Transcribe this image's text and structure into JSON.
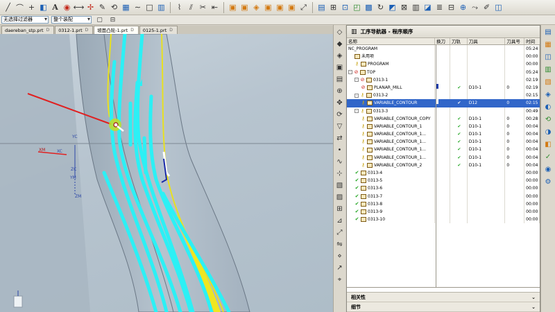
{
  "toolbar": {
    "filter_combo": "无选择过滤器",
    "assembly_combo": "整个装配"
  },
  "tabs": [
    {
      "label": "daereban_stp.prt",
      "active": false
    },
    {
      "label": "0312-1.prt",
      "active": false
    },
    {
      "label": "坡面凸轮-1.prt",
      "active": true
    },
    {
      "label": "0125-1.prt",
      "active": false
    }
  ],
  "viewport": {
    "axis_labels": [
      "YC",
      "ZC",
      "XC",
      "ZM",
      "YM",
      "XM"
    ]
  },
  "navigator": {
    "title": "工序导航器 - 程序顺序",
    "columns": {
      "name": "名称",
      "tool_change": "换刀",
      "path": "刀轨",
      "tool": "刀具",
      "tool_no": "刀具号",
      "time": "时间"
    },
    "rows": [
      {
        "indent": 0,
        "name": "NC_PROGRAM",
        "tool_change": "",
        "path": "",
        "tool": "",
        "tool_no": "",
        "time": "05:24",
        "expander": "",
        "status": "",
        "op_icon": false,
        "selected": false
      },
      {
        "indent": 1,
        "name": "未用项",
        "tool_change": "",
        "path": "",
        "tool": "",
        "tool_no": "",
        "time": "00:00",
        "expander": "",
        "status": "",
        "op_icon": true,
        "selected": false
      },
      {
        "indent": 1,
        "name": "PROGRAM",
        "tool_change": "",
        "path": "",
        "tool": "",
        "tool_no": "",
        "time": "00:00",
        "expander": "",
        "status": "key",
        "op_icon": true,
        "selected": false
      },
      {
        "indent": 0,
        "name": "TOP",
        "tool_change": "",
        "path": "",
        "tool": "",
        "tool_no": "",
        "time": "05:24",
        "expander": "-",
        "status": "noentry",
        "op_icon": true,
        "selected": false
      },
      {
        "indent": 1,
        "name": "0313-1",
        "tool_change": "",
        "path": "",
        "tool": "",
        "tool_no": "",
        "time": "02:19",
        "expander": "-",
        "status": "noentry",
        "op_icon": true,
        "selected": false
      },
      {
        "indent": 2,
        "name": "PLANAR_MILL",
        "tool_change": "bar",
        "path": "check",
        "tool": "D10-1",
        "tool_no": "0",
        "time": "02:19",
        "expander": "",
        "status": "noentry",
        "op_icon": true,
        "selected": false
      },
      {
        "indent": 1,
        "name": "0313-2",
        "tool_change": "",
        "path": "",
        "tool": "",
        "tool_no": "",
        "time": "02:15",
        "expander": "-",
        "status": "key",
        "op_icon": true,
        "selected": false
      },
      {
        "indent": 2,
        "name": "VARIABLE_CONTOUR",
        "tool_change": "bar",
        "path": "check",
        "tool": "D12",
        "tool_no": "0",
        "time": "02:15",
        "expander": "",
        "status": "key",
        "op_icon": true,
        "selected": true
      },
      {
        "indent": 1,
        "name": "0313-3",
        "tool_change": "",
        "path": "",
        "tool": "",
        "tool_no": "",
        "time": "00:49",
        "expander": "-",
        "status": "key",
        "op_icon": true,
        "selected": false
      },
      {
        "indent": 2,
        "name": "VARIABLE_CONTOUR_COPY",
        "tool_change": "",
        "path": "check",
        "tool": "D10-1",
        "tool_no": "0",
        "time": "00:28",
        "expander": "",
        "status": "key",
        "op_icon": true,
        "selected": false
      },
      {
        "indent": 2,
        "name": "VARIABLE_CONTOUR_1",
        "tool_change": "",
        "path": "check",
        "tool": "D10-1",
        "tool_no": "0",
        "time": "00:04",
        "expander": "",
        "status": "key",
        "op_icon": true,
        "selected": false
      },
      {
        "indent": 2,
        "name": "VARIABLE_CONTOUR_1...",
        "tool_change": "",
        "path": "check",
        "tool": "D10-1",
        "tool_no": "0",
        "time": "00:04",
        "expander": "",
        "status": "key",
        "op_icon": true,
        "selected": false
      },
      {
        "indent": 2,
        "name": "VARIABLE_CONTOUR_1...",
        "tool_change": "",
        "path": "check",
        "tool": "D10-1",
        "tool_no": "0",
        "time": "00:04",
        "expander": "",
        "status": "key",
        "op_icon": true,
        "selected": false
      },
      {
        "indent": 2,
        "name": "VARIABLE_CONTOUR_1...",
        "tool_change": "",
        "path": "check",
        "tool": "D10-1",
        "tool_no": "0",
        "time": "00:04",
        "expander": "",
        "status": "key",
        "op_icon": true,
        "selected": false
      },
      {
        "indent": 2,
        "name": "VARIABLE_CONTOUR_1...",
        "tool_change": "",
        "path": "check",
        "tool": "D10-1",
        "tool_no": "0",
        "time": "00:04",
        "expander": "",
        "status": "key",
        "op_icon": true,
        "selected": false
      },
      {
        "indent": 2,
        "name": "VARIABLE_CONTOUR_2",
        "tool_change": "",
        "path": "check",
        "tool": "D10-1",
        "tool_no": "0",
        "time": "00:04",
        "expander": "",
        "status": "key",
        "op_icon": true,
        "selected": false
      },
      {
        "indent": 1,
        "name": "0313-4",
        "tool_change": "",
        "path": "",
        "tool": "",
        "tool_no": "",
        "time": "00:00",
        "expander": "",
        "status": "check",
        "op_icon": true,
        "selected": false
      },
      {
        "indent": 1,
        "name": "0313-5",
        "tool_change": "",
        "path": "",
        "tool": "",
        "tool_no": "",
        "time": "00:00",
        "expander": "",
        "status": "check",
        "op_icon": true,
        "selected": false
      },
      {
        "indent": 1,
        "name": "0313-6",
        "tool_change": "",
        "path": "",
        "tool": "",
        "tool_no": "",
        "time": "00:00",
        "expander": "",
        "status": "check",
        "op_icon": true,
        "selected": false
      },
      {
        "indent": 1,
        "name": "0313-7",
        "tool_change": "",
        "path": "",
        "tool": "",
        "tool_no": "",
        "time": "00:00",
        "expander": "",
        "status": "check",
        "op_icon": true,
        "selected": false
      },
      {
        "indent": 1,
        "name": "0313-8",
        "tool_change": "",
        "path": "",
        "tool": "",
        "tool_no": "",
        "time": "00:00",
        "expander": "",
        "status": "check",
        "op_icon": true,
        "selected": false
      },
      {
        "indent": 1,
        "name": "0313-9",
        "tool_change": "",
        "path": "",
        "tool": "",
        "tool_no": "",
        "time": "00:00",
        "expander": "",
        "status": "check",
        "op_icon": true,
        "selected": false
      },
      {
        "indent": 1,
        "name": "0313-10",
        "tool_change": "",
        "path": "",
        "tool": "",
        "tool_no": "",
        "time": "00:00",
        "expander": "",
        "status": "check",
        "op_icon": true,
        "selected": false
      }
    ],
    "bottom_sections": [
      "相关性",
      "细节"
    ]
  }
}
